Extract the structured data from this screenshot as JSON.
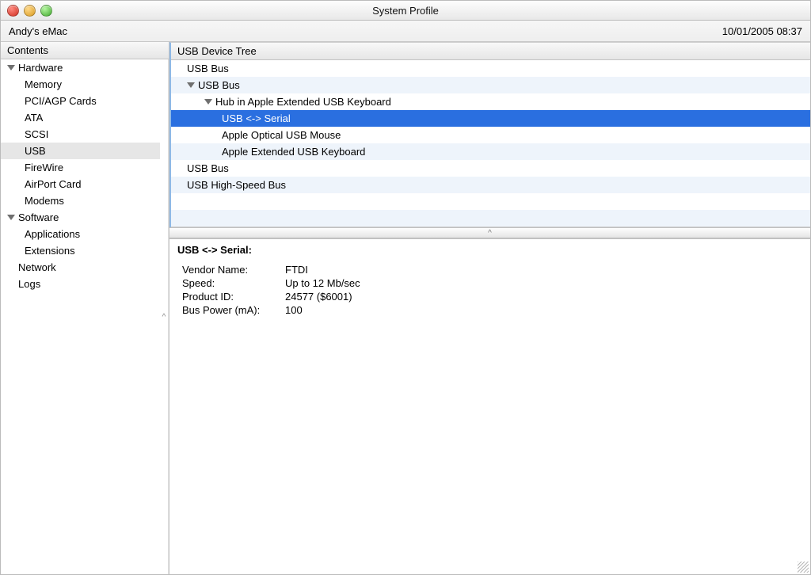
{
  "window": {
    "title": "System Profile"
  },
  "infobar": {
    "machine": "Andy's eMac",
    "timestamp": "10/01/2005 08:37"
  },
  "sidebar": {
    "header": "Contents",
    "hardware": {
      "label": "Hardware",
      "items": [
        "Memory",
        "PCI/AGP Cards",
        "ATA",
        "SCSI",
        "USB",
        "FireWire",
        "AirPort Card",
        "Modems"
      ],
      "selected": "USB"
    },
    "software": {
      "label": "Software",
      "items": [
        "Applications",
        "Extensions"
      ]
    },
    "network": "Network",
    "logs": "Logs"
  },
  "device_tree": {
    "header": "USB Device Tree",
    "rows": [
      {
        "label": "USB Bus",
        "indent": 0,
        "disclosure": "none",
        "selected": false
      },
      {
        "label": "USB Bus",
        "indent": 0,
        "disclosure": "down",
        "selected": false
      },
      {
        "label": "Hub in Apple Extended USB Keyboard",
        "indent": 1,
        "disclosure": "down",
        "selected": false
      },
      {
        "label": "USB <-> Serial",
        "indent": 2,
        "disclosure": "none",
        "selected": true
      },
      {
        "label": "Apple Optical USB Mouse",
        "indent": 2,
        "disclosure": "none",
        "selected": false
      },
      {
        "label": "Apple Extended USB Keyboard",
        "indent": 2,
        "disclosure": "none",
        "selected": false
      },
      {
        "label": "USB Bus",
        "indent": 0,
        "disclosure": "none",
        "selected": false
      },
      {
        "label": "USB High-Speed Bus",
        "indent": 0,
        "disclosure": "none",
        "selected": false
      }
    ]
  },
  "details": {
    "title": "USB <-> Serial:",
    "rows": [
      {
        "k": "Vendor Name:",
        "v": "FTDI"
      },
      {
        "k": "Speed:",
        "v": "Up to 12 Mb/sec"
      },
      {
        "k": "Product ID:",
        "v": "24577 ($6001)"
      },
      {
        "k": "Bus Power (mA):",
        "v": "100"
      }
    ]
  }
}
